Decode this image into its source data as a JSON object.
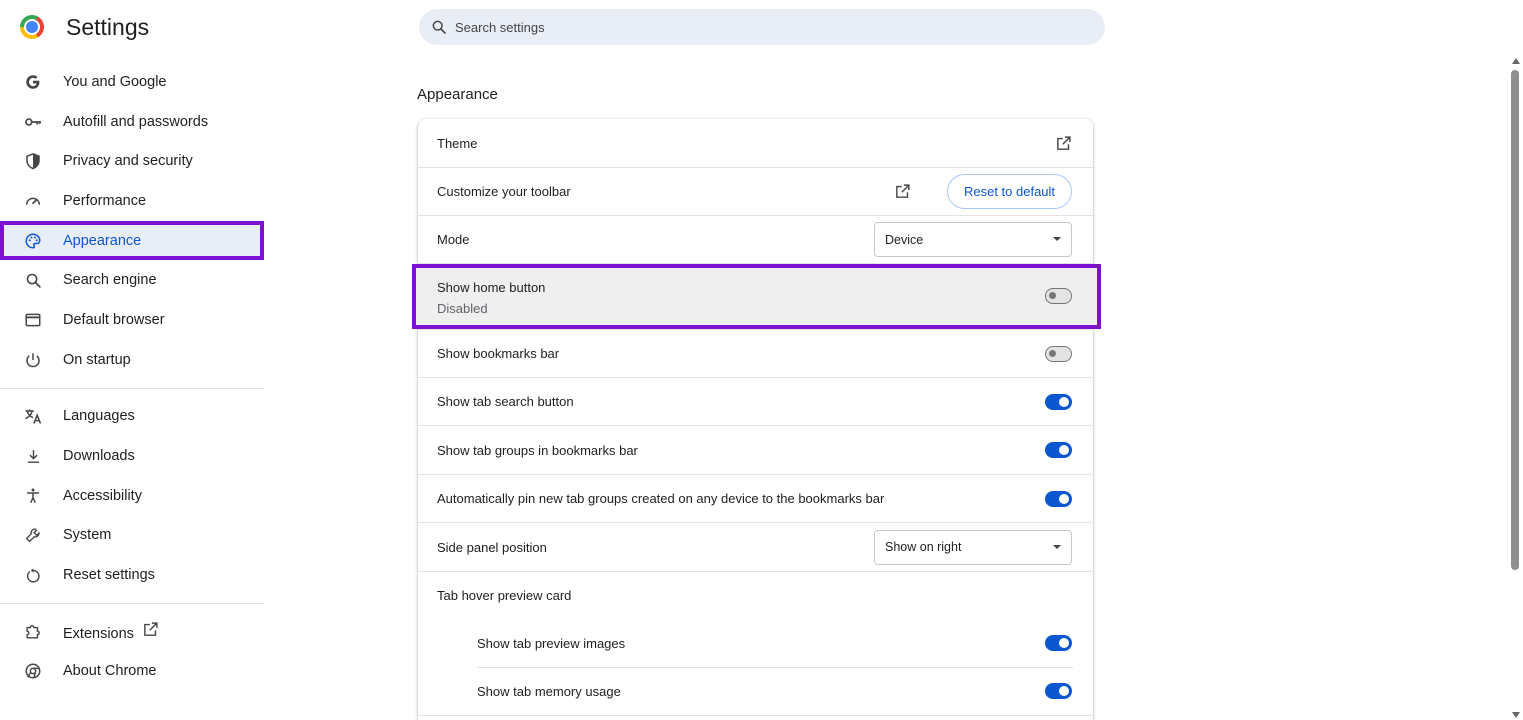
{
  "header": {
    "title": "Settings",
    "search_placeholder": "Search settings"
  },
  "sidebar": {
    "items": [
      {
        "label": "You and Google",
        "icon": "google-g-icon"
      },
      {
        "label": "Autofill and passwords",
        "icon": "key-icon"
      },
      {
        "label": "Privacy and security",
        "icon": "shield-icon"
      },
      {
        "label": "Performance",
        "icon": "speedometer-icon"
      },
      {
        "label": "Appearance",
        "icon": "palette-icon",
        "active": true
      },
      {
        "label": "Search engine",
        "icon": "search-icon"
      },
      {
        "label": "Default browser",
        "icon": "browser-window-icon"
      },
      {
        "label": "On startup",
        "icon": "power-icon"
      },
      {
        "label": "Languages",
        "icon": "translate-icon"
      },
      {
        "label": "Downloads",
        "icon": "download-icon"
      },
      {
        "label": "Accessibility",
        "icon": "accessibility-icon"
      },
      {
        "label": "System",
        "icon": "wrench-icon"
      },
      {
        "label": "Reset settings",
        "icon": "reset-icon"
      },
      {
        "label": "Extensions",
        "icon": "puzzle-icon"
      },
      {
        "label": "About Chrome",
        "icon": "chrome-icon"
      }
    ]
  },
  "appearance": {
    "section_title": "Appearance",
    "theme_label": "Theme",
    "toolbar_label": "Customize your toolbar",
    "reset_button": "Reset to default",
    "mode_label": "Mode",
    "mode_value": "Device",
    "home_button_label": "Show home button",
    "home_button_sub": "Disabled",
    "bookmarks_bar_label": "Show bookmarks bar",
    "tab_search_label": "Show tab search button",
    "tab_groups_label": "Show tab groups in bookmarks bar",
    "auto_pin_label": "Automatically pin new tab groups created on any device to the bookmarks bar",
    "side_panel_label": "Side panel position",
    "side_panel_value": "Show on right",
    "hover_card_label": "Tab hover preview card",
    "preview_images_label": "Show tab preview images",
    "memory_usage_label": "Show tab memory usage"
  },
  "toggles": {
    "home_button": false,
    "bookmarks_bar": false,
    "tab_search": true,
    "tab_groups": true,
    "auto_pin": true,
    "preview_images": true,
    "memory_usage": true
  },
  "colors": {
    "accent": "#0b57d0",
    "highlight": "#7e10d1",
    "active_bg": "#e8eef8"
  }
}
